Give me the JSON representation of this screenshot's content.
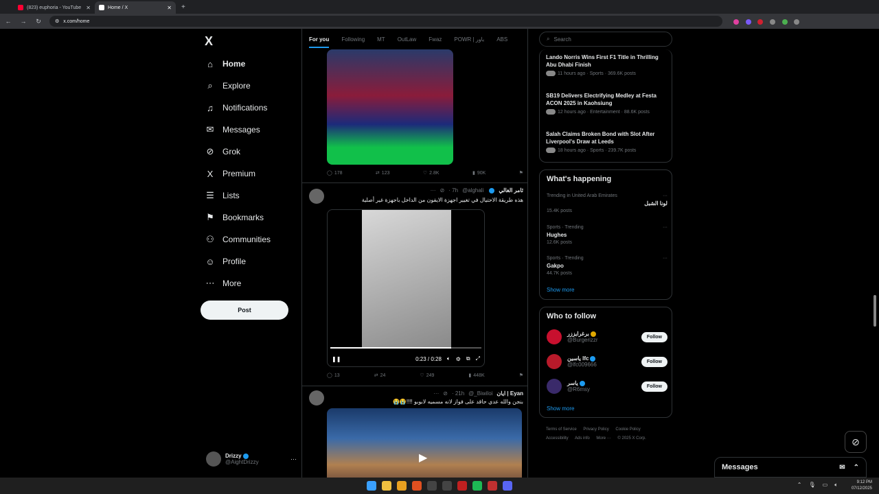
{
  "browser": {
    "tabs": [
      {
        "title": "(823) euphoria - YouTube",
        "fav_color": "#ff0033"
      },
      {
        "title": "Home / X",
        "fav_color": "#ffffff"
      }
    ],
    "url": "x.com/home"
  },
  "sidebar": {
    "logo": "X",
    "items": [
      {
        "label": "Home",
        "icon": "home-icon",
        "glyph": "⌂"
      },
      {
        "label": "Explore",
        "icon": "search-icon",
        "glyph": "⌕"
      },
      {
        "label": "Notifications",
        "icon": "bell-icon",
        "glyph": "♫"
      },
      {
        "label": "Messages",
        "icon": "mail-icon",
        "glyph": "✉"
      },
      {
        "label": "Grok",
        "icon": "grok-icon",
        "glyph": "⊘"
      },
      {
        "label": "Premium",
        "icon": "x-icon",
        "glyph": "X"
      },
      {
        "label": "Lists",
        "icon": "list-icon",
        "glyph": "☰"
      },
      {
        "label": "Bookmarks",
        "icon": "bookmark-icon",
        "glyph": "⚑"
      },
      {
        "label": "Communities",
        "icon": "people-icon",
        "glyph": "⚇"
      },
      {
        "label": "Profile",
        "icon": "person-icon",
        "glyph": "☺"
      },
      {
        "label": "More",
        "icon": "more-icon",
        "glyph": "⋯"
      }
    ],
    "post_label": "Post",
    "user": {
      "name": "Drizzy",
      "handle": "@AightDrizzy",
      "more": "···"
    }
  },
  "feed": {
    "tabs": [
      "For you",
      "Following",
      "MT",
      "OutLaw",
      "Fwaz",
      "POWR | باور",
      "ABS"
    ],
    "tweets": [
      {
        "actions": {
          "replies": "178",
          "reposts": "123",
          "likes": "2.8K",
          "views": "90K"
        }
      },
      {
        "name": "ثامر الغالي",
        "handle": "@alghali",
        "time": "· 7h",
        "text": "هذه طريقة الاحتيال في تغيير اجهزة الايفون من الداخل باجهزة غير أصلية",
        "video_time": "0:23 / 0:28",
        "actions": {
          "replies": "13",
          "reposts": "24",
          "likes": "249",
          "views": "448K"
        }
      },
      {
        "name": "ايان | Eyan",
        "handle": "@_Biwiloi",
        "time": "· 21h",
        "text": "بنجن والله عدي حاقد على فواز لانه مسميه لابوبو !!!!😭😭"
      }
    ]
  },
  "right": {
    "search_placeholder": "Search",
    "news": [
      {
        "title": "Lando Norris Wins First F1 Title in Thrilling Abu Dhabi Finish",
        "meta": "11 hours ago · Sports · 369.6K posts"
      },
      {
        "title": "SB19 Delivers Electrifying Medley at Festa ACON 2025 in Kaohsiung",
        "meta": "12 hours ago · Entertainment · 88.6K posts"
      },
      {
        "title": "Salah Claims Broken Bond with Slot After Liverpool's Draw at Leeds",
        "meta": "18 hours ago · Sports · 239.7K posts"
      }
    ],
    "happening": {
      "title": "What's happening",
      "trends": [
        {
          "meta": "Trending in United Arab Emirates",
          "name": "لونا الشبل",
          "count": "15.4K posts"
        },
        {
          "meta": "Sports · Trending",
          "name": "Hughes",
          "count": "12.6K posts"
        },
        {
          "meta": "Sports · Trending",
          "name": "Gakpo",
          "count": "44.7K posts"
        }
      ],
      "show_more": "Show more"
    },
    "who_to_follow": {
      "title": "Who to follow",
      "users": [
        {
          "name": "برغرايززر",
          "handle": "@Burgerizzr",
          "avatar_color": "#c8102e"
        },
        {
          "name": "ياسين lfc",
          "handle": "@lfc009666",
          "avatar_color": "#b81a2a"
        },
        {
          "name": "ياسر",
          "handle": "@R6msy",
          "avatar_color": "#3a2a6a"
        }
      ],
      "follow_label": "Follow",
      "show_more": "Show more"
    },
    "footer": [
      "Terms of Service",
      "Privacy Policy",
      "Cookie Policy",
      "Accessibility",
      "Ads info",
      "More ···",
      "© 2025 X Corp."
    ]
  },
  "messages_drawer": {
    "title": "Messages"
  },
  "taskbar": {
    "time": "9:12 PM",
    "date": "07/12/2025"
  }
}
